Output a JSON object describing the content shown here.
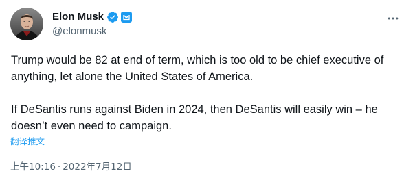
{
  "author": {
    "display_name": "Elon Musk",
    "handle": "@elonmusk"
  },
  "tweet": {
    "paragraphs": [
      "Trump would be 82 at end of term, which is too old to be chief executive of anything, let alone the United States of America.",
      "If DeSantis runs against Biden in 2024, then DeSantis will easily win – he doesn’t even need to campaign."
    ],
    "translate_label": "翻译推文"
  },
  "meta": {
    "time": "上午10:16",
    "separator": "·",
    "date": "2022年7月12日"
  },
  "icons": {
    "verified": "verified-badge-icon",
    "affiliate": "affiliate-badge-icon",
    "more": "more-options-icon"
  },
  "colors": {
    "accent": "#1d9bf0",
    "text_primary": "#0f1419",
    "text_secondary": "#536471"
  }
}
